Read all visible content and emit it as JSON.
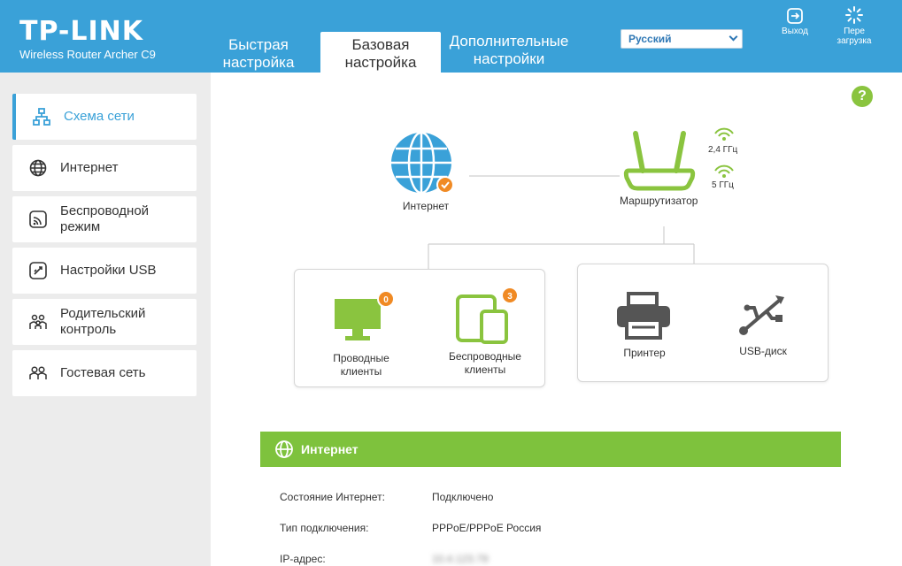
{
  "header": {
    "logo_title": "TP-LINK",
    "logo_subtitle": "Wireless Router Archer C9",
    "tabs": [
      {
        "label": "Быстрая\nнастройка"
      },
      {
        "label": "Базовая\nнастройка"
      },
      {
        "label": "Дополнительные\nнастройки"
      }
    ],
    "active_tab": "Базовая настройка",
    "language": "Русский",
    "logout_label": "Выход",
    "reboot_label": "Пере\nзагрузка"
  },
  "sidebar": {
    "items": [
      {
        "label": "Схема сети",
        "icon": "network-map-icon"
      },
      {
        "label": "Интернет",
        "icon": "globe-icon"
      },
      {
        "label": "Беспроводной\nрежим",
        "icon": "wireless-icon"
      },
      {
        "label": "Настройки USB",
        "icon": "usb-settings-icon"
      },
      {
        "label": "Родительский\nконтроль",
        "icon": "parental-control-icon"
      },
      {
        "label": "Гостевая сеть",
        "icon": "guest-network-icon"
      }
    ]
  },
  "help": {
    "label": "?"
  },
  "diagram": {
    "internet_label": "Интернет",
    "router_label": "Маршрутизатор",
    "freq_24": "2,4 ГГц",
    "freq_5": "5 ГГц",
    "wired_label": "Проводные\nклиенты",
    "wired_count": "0",
    "wireless_label": "Беспроводные\nклиенты",
    "wireless_count": "3",
    "printer_label": "Принтер",
    "usb_label": "USB-диск"
  },
  "internet_section": {
    "title": "Интернет",
    "rows": [
      {
        "key": "Состояние Интернет:",
        "value": "Подключено"
      },
      {
        "key": "Тип подключения:",
        "value": "PPPoE/PPPoE Россия"
      },
      {
        "key": "IP-адрес:",
        "value": "10.4.123.79"
      }
    ]
  },
  "colors": {
    "header_blue": "#3aa1d8",
    "accent_green": "#7ec23d",
    "badge_orange": "#f08a24"
  }
}
